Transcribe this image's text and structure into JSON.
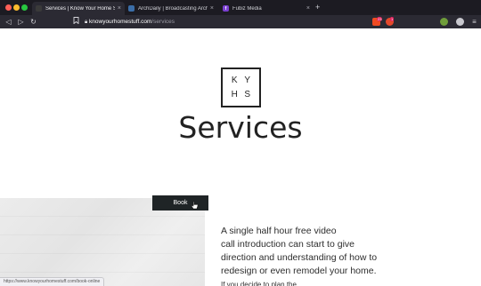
{
  "browser": {
    "tabs": [
      {
        "title": "Services | Know Your Home Stu",
        "active": true,
        "favicon_color": "#3a3a3a",
        "favicon_letter": ""
      },
      {
        "title": "ArchDaily | Broadcasting Archite",
        "active": false,
        "favicon_color": "#3b6ea8",
        "favicon_letter": ""
      },
      {
        "title": "Fubiz Media",
        "active": false,
        "favicon_color": "#7a3fd0",
        "favicon_letter": "f"
      }
    ],
    "new_tab_label": "+",
    "close_label": "×",
    "url_host": "knowyourhomestuff.com",
    "url_path": "/services",
    "extensions": [
      {
        "name": "brave-shield",
        "color": "#f04b22",
        "badge": "23"
      },
      {
        "name": "brave-rewards",
        "color": "#e5492c",
        "badge": "1"
      }
    ],
    "status_url": "https://www.knowyourhomestuff.com/book-online"
  },
  "page": {
    "logo_letters": [
      "K",
      "Y",
      "H",
      "S"
    ],
    "heading": "Services",
    "book_button": "Book",
    "intro_lines": [
      "A single half hour free video",
      "call introduction can start to give",
      "direction and understanding of how to",
      "redesign or even remodel your home."
    ],
    "intro_partial": "If you decide to plan the"
  }
}
